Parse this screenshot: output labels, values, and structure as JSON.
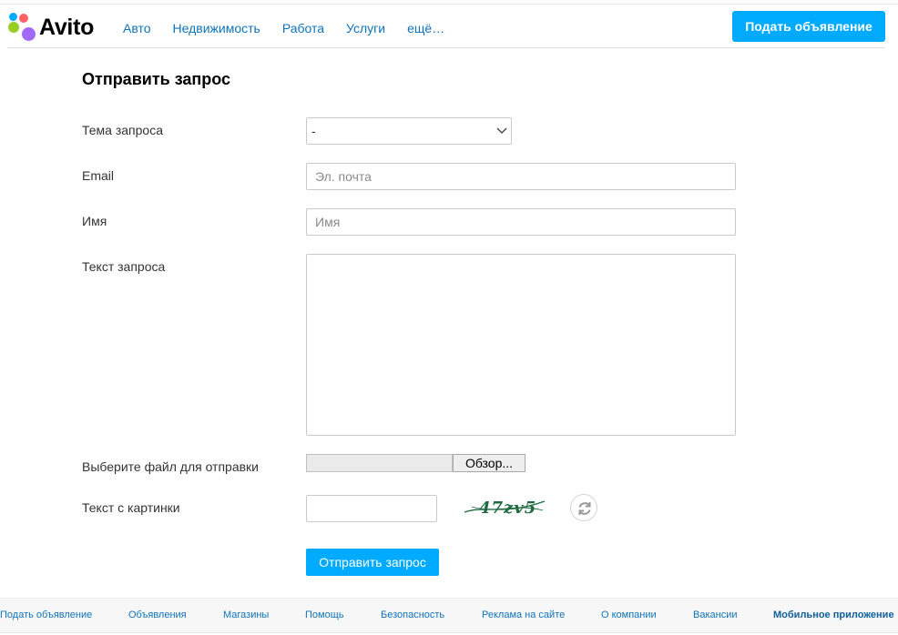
{
  "header": {
    "logo_text": "Avito",
    "nav": [
      "Авто",
      "Недвижимость",
      "Работа",
      "Услуги",
      "ещё…"
    ],
    "post_button": "Подать объявление"
  },
  "form": {
    "title": "Отправить запрос",
    "topic_label": "Тема запроса",
    "topic_value": "-",
    "email_label": "Email",
    "email_placeholder": "Эл. почта",
    "name_label": "Имя",
    "name_placeholder": "Имя",
    "message_label": "Текст запроса",
    "file_label": "Выберите файл для отправки",
    "file_button": "Обзор...",
    "captcha_label": "Текст с картинки",
    "captcha_text": "47zv5",
    "submit": "Отправить запрос"
  },
  "footer": {
    "links": [
      "Подать объявление",
      "Объявления",
      "Магазины",
      "Помощь",
      "Безопасность",
      "Реклама на сайте",
      "О компании",
      "Вакансии",
      "Мобильное приложение"
    ]
  },
  "colors": {
    "accent": "#00aaff",
    "link": "#0f74b8"
  },
  "icons": [
    "logo-dots-icon",
    "chevron-down-icon",
    "refresh-icon"
  ]
}
